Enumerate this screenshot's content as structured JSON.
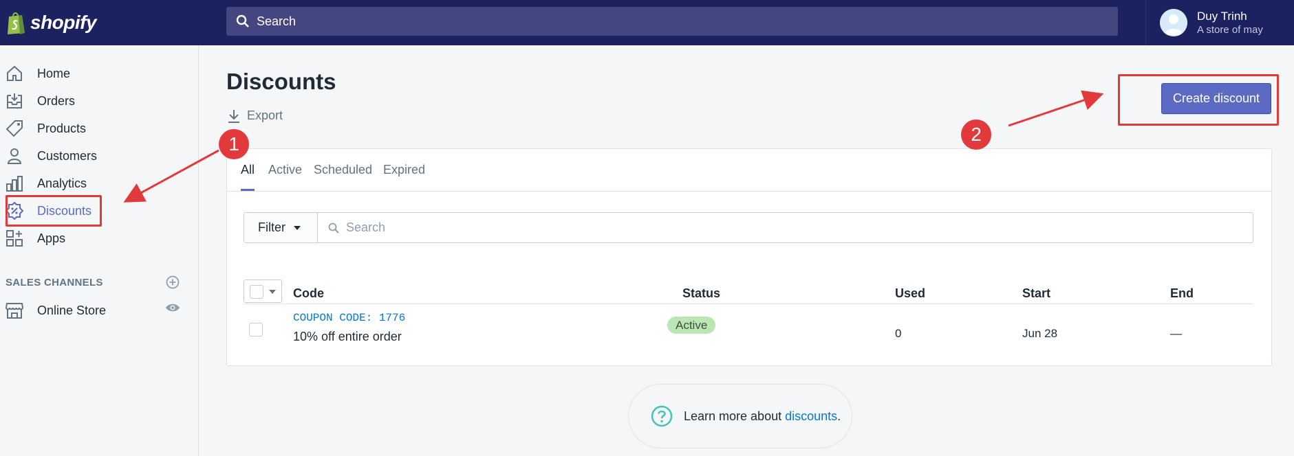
{
  "topbar": {
    "logo_text": "shopify",
    "search_placeholder": "Search",
    "user_name": "Duy Trinh",
    "user_store": "A store of may"
  },
  "sidebar": {
    "items": [
      {
        "label": "Home",
        "icon": "home-icon"
      },
      {
        "label": "Orders",
        "icon": "orders-icon"
      },
      {
        "label": "Products",
        "icon": "tag-icon"
      },
      {
        "label": "Customers",
        "icon": "person-icon"
      },
      {
        "label": "Analytics",
        "icon": "bar-chart-icon"
      },
      {
        "label": "Discounts",
        "icon": "discount-icon",
        "active": true
      },
      {
        "label": "Apps",
        "icon": "apps-icon"
      }
    ],
    "sales_channels_title": "SALES CHANNELS",
    "online_store": "Online Store"
  },
  "page": {
    "title": "Discounts",
    "export_label": "Export",
    "create_button": "Create discount"
  },
  "tabs": [
    "All",
    "Active",
    "Scheduled",
    "Expired"
  ],
  "filter": {
    "button_label": "Filter",
    "search_placeholder": "Search"
  },
  "table": {
    "columns": [
      "Code",
      "Status",
      "Used",
      "Start",
      "End"
    ],
    "rows": [
      {
        "code": "COUPON CODE: 1776",
        "description": "10% off entire order",
        "status": "Active",
        "used": "0",
        "start": "Jun 28",
        "end": "—"
      }
    ]
  },
  "learn_more": {
    "prefix": "Learn more about ",
    "link": "discounts",
    "suffix": "."
  },
  "annotations": {
    "step1": "1",
    "step2": "2",
    "color": "#e2393b"
  },
  "colors": {
    "topbar": "#1c2260",
    "accent": "#5c6ac4",
    "link": "#007ace",
    "badge_active": "#bbe5b3"
  }
}
